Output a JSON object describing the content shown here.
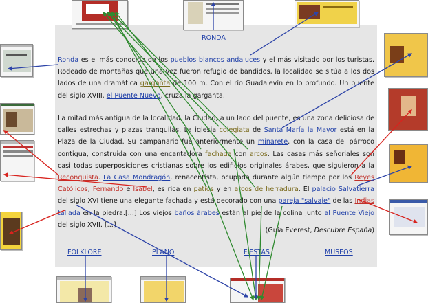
{
  "nav": {
    "top": "RONDA",
    "folklore": "FOLKLORE",
    "plano": "PLANO",
    "fiestas": "FIESTAS",
    "museos": "MUSEOS"
  },
  "p1": {
    "ronda": "Ronda",
    "t1": " es el más conocido de los ",
    "pueblos": "pueblos blancos andaluces",
    "t2": " y el más visitado por los turistas. Rodeado de montañas que una vez fueron refugio de bandidos, la localidad se sitúa a los dos lados de una dramática ",
    "garganta": "garganta",
    "t3": " de 100 m. Con el río Guadalevín en lo profundo. Un puente del siglo XVIII, ",
    "puente": "el Puente Nuevo",
    "t4": ", cruza la garganta."
  },
  "p2": {
    "t1": "La mitad más antigua de la localidad, la Ciudad, a un lado del puente, es una zona deliciosa de calles estrechas y plazas tranquilas. La iglesia ",
    "colegiata": "colegiata",
    "t2": " de ",
    "santamaria": "Santa María la Mayor",
    "t3": " está en la Plaza de la Ciudad. Su campanario fue anteriormente un ",
    "minarete": "minarete",
    "t4": ", con la casa del párroco contigua, construida con una encantadora ",
    "fachada": "fachada",
    "t5": " con ",
    "arcos": "arcos",
    "t6": ". Las casas más señoriales son casi todas superposiciones cristianas sobre los edificios originales árabes, que siguieron a la ",
    "reconquista": "Reconquista",
    "t7": ". ",
    "mondragon": "La Casa Mondragón",
    "t8": ", renacentista, ocupada durante algún tiempo por los ",
    "reyes": "Reyes Católicos",
    "t9": ", ",
    "fernando": "Fernando",
    "t10": " e ",
    "isabel": "Isabel",
    "t11": ", es rica en ",
    "patios": "patios",
    "t12": " y en ",
    "herradura": "arcos de herradura",
    "t13": ". El ",
    "palacio": "palacio Salvatierra",
    "t14": " del siglo XVI tiene una elegante fachada y está decorado con una ",
    "pareja": "pareja \"salvaje\"",
    "t15": " de las ",
    "indias": "Indias",
    "t16": " ",
    "tallada": "tallada",
    "t17": " en la piedra.[...] Los viejos ",
    "banos": "baños árabes",
    "t18": " están al pie de la colina junto ",
    "puenteviejo": "al Puente Viejo",
    "t19": " del siglo XVII. [...]"
  },
  "citation": {
    "open": "(Guía Everest, ",
    "book": "Descubre España",
    "close": ")"
  },
  "colors": {
    "panel": "#e6e6e6",
    "link_blue": "#1f3fa8",
    "link_red": "#c0322b",
    "link_olive": "#7a6a1c",
    "arrow_green": "#2f8a2f",
    "arrow_blue": "#2d44a8",
    "arrow_red": "#d8231e"
  }
}
